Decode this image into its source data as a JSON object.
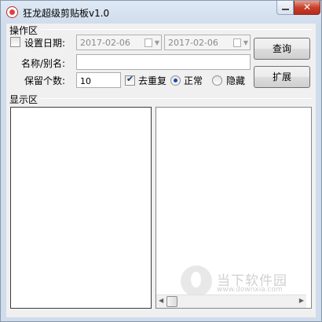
{
  "window": {
    "title": "狂龙超级剪贴板v1.0",
    "close_glyph": "✕"
  },
  "ops": {
    "group_label": "操作区",
    "set_date_label": "设置日期:",
    "set_date_checked": false,
    "date_from": "2017-02-06",
    "date_to": "2017-02-06",
    "name_label": "名称/别名:",
    "name_value": "",
    "keep_count_label": "保留个数:",
    "keep_count_value": "10",
    "dedupe_label": "去重复",
    "dedupe_checked": true,
    "mode_normal_label": "正常",
    "mode_hidden_label": "隐藏",
    "selected_mode": "正常",
    "query_button": "查询",
    "expand_button": "扩展"
  },
  "display": {
    "group_label": "显示区"
  },
  "watermark": {
    "title": "当下软件园",
    "url": "www.downxia.com"
  },
  "icons": {
    "app": "app-logo-icon",
    "calendar": "calendar-icon",
    "dropdown": "chevron-down-icon"
  }
}
